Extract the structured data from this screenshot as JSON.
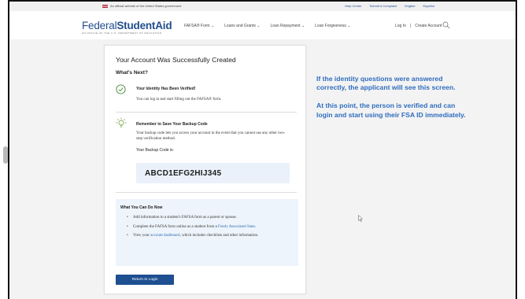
{
  "gov_banner": {
    "text": "An official website of the United States government",
    "links": [
      "Help Center",
      "Submit a Complaint",
      "English",
      "Español"
    ]
  },
  "header": {
    "logo_regular": "Federal",
    "logo_bold": "StudentAid",
    "logo_sub": "AN OFFICE OF THE U.S. DEPARTMENT OF EDUCATION",
    "nav": [
      "FAFSA® Form ⌄",
      "Loans and Grants ⌄",
      "Loan Repayment ⌄",
      "Loan Forgiveness ⌄"
    ],
    "login_label": "Log In",
    "separator": "|",
    "create_account_label": "Create Account"
  },
  "card": {
    "title": "Your Account Was Successfully Created",
    "subtitle": "What's Next?",
    "step1_title": "Your Identity Has Been Verified!",
    "step1_text": "You can log in and start filling out the FAFSA® form.",
    "step2_title": "Remember to Save Your Backup Code",
    "step2_text": "Your backup code lets you access your account in the event that you cannot use any other two-step verification method.",
    "code_label": "Your Backup Code is:",
    "code_value": "ABCD1EFG2HIJ345",
    "todo_title": "What You Can Do Now",
    "todo": {
      "item1": "Add information to a student's FAFSA form as a parent or spouse.",
      "item2_pre": "Complete the FAFSA form online as a student from a ",
      "item2_link": "Freely Associated State",
      "item2_post": ".",
      "item3_pre": "View your ",
      "item3_link": "account dashboard",
      "item3_post": ", which includes checklists and other information."
    },
    "return_button": "Return to Login"
  },
  "annotation": {
    "p1": "If the identity questions were answered correctly, the applicant will see this screen.",
    "p2": "At this point, the person is verified and can login and start using their FSA ID immediately."
  },
  "colors": {
    "brand_blue": "#1d4f91",
    "annotation_blue": "#2f6dbf",
    "code_bg": "#eaf1fb"
  }
}
